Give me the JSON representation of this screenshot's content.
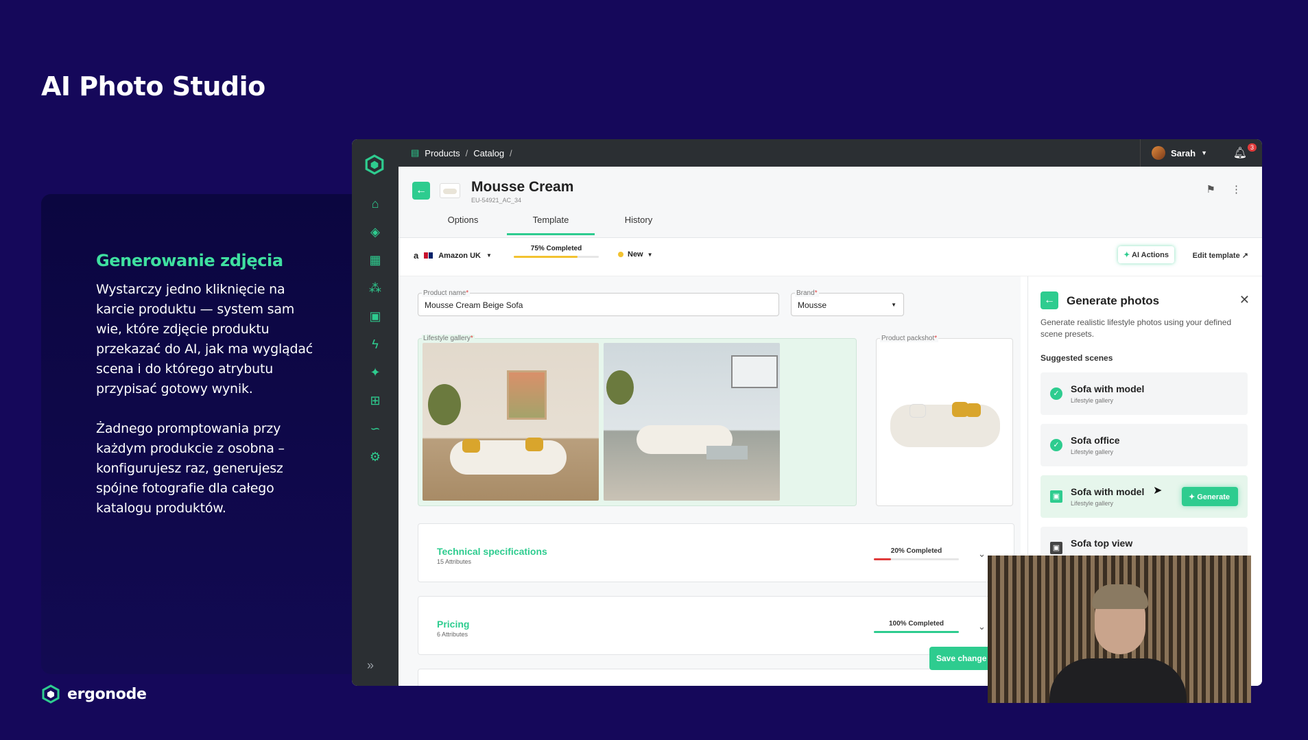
{
  "slide": {
    "title": "AI Photo Studio",
    "heading": "Generowanie zdjęcia",
    "paragraph1": "Wystarczy jedno kliknięcie na karcie produktu — system sam wie, które zdjęcie produktu przekazać do AI, jak ma wyglądać scena i do którego atrybutu przypisać gotowy wynik.",
    "paragraph2": "Żadnego promptowania przy każdym produkcie z osobna – konfigurujesz raz, generujesz spójne fotografie dla całego katalogu produktów.",
    "brand": "ergonode"
  },
  "colors": {
    "background": "#15085a",
    "accent": "#2ecc8f",
    "sidebar": "#2b2f33"
  },
  "app": {
    "breadcrumb": [
      "Products",
      "Catalog"
    ],
    "user": "Sarah",
    "notifications": "3",
    "product": {
      "title": "Mousse Cream",
      "code": "EU-54921_AC_34"
    },
    "tabs": [
      "Options",
      "Template",
      "History"
    ],
    "active_tab": "Template",
    "toolbar": {
      "market": "Amazon UK",
      "completion_label": "75% Completed",
      "completion": 0.75,
      "status": "New",
      "ai_actions": "AI Actions",
      "edit_template": "Edit template"
    },
    "fields": {
      "product_name_label": "Product name",
      "product_name_value": "Mousse Cream Beige Sofa",
      "brand_label": "Brand",
      "brand_value": "Mousse",
      "gallery_label": "Lifestyle gallery",
      "packshot_label": "Product packshot"
    },
    "sections": [
      {
        "title": "Technical specifications",
        "subtitle": "15 Attributes",
        "completion_label": "20% Completed",
        "completion": 0.2,
        "color": "#e03b3b"
      },
      {
        "title": "Pricing",
        "subtitle": "6 Attributes",
        "completion_label": "100% Completed",
        "completion": 1.0,
        "color": "#2ecc8f"
      }
    ],
    "save_button": "Save change",
    "panel": {
      "title": "Generate photos",
      "description": "Generate realistic lifestyle photos using your defined scene presets.",
      "subtitle": "Suggested scenes",
      "scenes": [
        {
          "name": "Sofa with model",
          "sub": "Lifestyle gallery",
          "state": "done"
        },
        {
          "name": "Sofa office",
          "sub": "Lifestyle gallery",
          "state": "done"
        },
        {
          "name": "Sofa with model",
          "sub": "Lifestyle gallery",
          "state": "pending"
        },
        {
          "name": "Sofa top view",
          "sub": "",
          "state": "pending"
        }
      ],
      "generate_button": "Generate"
    },
    "sidebar_icons": [
      "home-icon",
      "box-icon",
      "dashboard-icon",
      "workflow-icon",
      "image-icon",
      "lightning-icon",
      "sparkle-icon",
      "plus-square-icon",
      "signature-icon",
      "gear-icon"
    ]
  }
}
